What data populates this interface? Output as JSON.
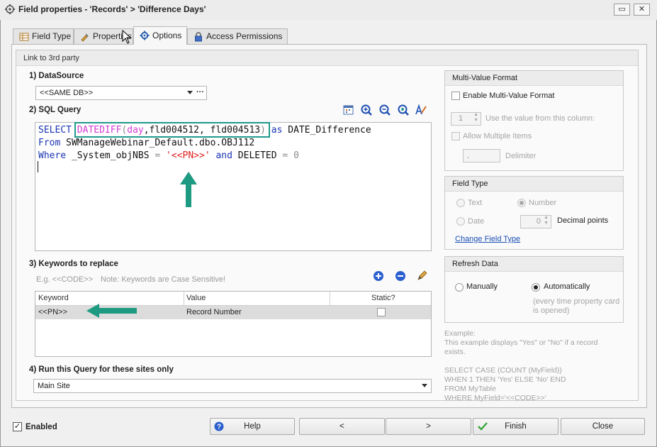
{
  "window": {
    "title": "Field properties - 'Records' > 'Difference Days'",
    "restore_glyph": "▭",
    "close_glyph": "✕"
  },
  "tabs": [
    {
      "label": "Field Type",
      "icon": "table-icon"
    },
    {
      "label": "Properties",
      "icon": "properties-icon"
    },
    {
      "label": "Options",
      "icon": "gear-icon"
    },
    {
      "label": "Access Permissions",
      "icon": "lock-icon"
    }
  ],
  "group": {
    "title": "Link to 3rd party"
  },
  "datasource": {
    "label": "1) DataSource",
    "value": "<<SAME DB>>",
    "more": "···"
  },
  "sql": {
    "label": "2) SQL Query",
    "line1": {
      "select": "SELECT",
      "fn": "DATEDIFF",
      "open": "(",
      "arg1": "day",
      "args_rest": ",fld004512, fld004513",
      "close": ")",
      "as": "as",
      "alias": "DATE_Difference"
    },
    "line2": {
      "from": "From",
      "table": "SWManageWebinar_Default.dbo.OBJ112"
    },
    "line3": {
      "where": "Where",
      "col": "_System_objNBS",
      "eq": "=",
      "str": "'<<PN>>'",
      "and": "and",
      "col2": "DELETED",
      "eq2": "=",
      "zero": "0"
    },
    "toolbar_icons": [
      "calendar-icon",
      "zoom-in-icon",
      "zoom-out-icon",
      "zoom-reset-icon",
      "format-icon"
    ]
  },
  "keywords": {
    "label": "3) Keywords to replace",
    "hint_example": "E.g. <<CODE>>",
    "hint_note": "Note: Keywords are Case Sensitive!",
    "columns": [
      "Keyword",
      "Value",
      "Static?"
    ],
    "rows": [
      {
        "keyword": "<<PN>>",
        "value": "Record Number",
        "static": false
      }
    ]
  },
  "sites": {
    "label": "4) Run this Query for these sites only",
    "value": "Main Site"
  },
  "multi_value": {
    "title": "Multi-Value Format",
    "enable_label": "Enable Multi-Value Format",
    "column_value": "1",
    "column_label": "Use the value from this column:",
    "allow_multiple_label": "Allow Multiple Items",
    "delimiter_value": ",",
    "delimiter_label": "Delimiter"
  },
  "field_type": {
    "title": "Field Type",
    "text_label": "Text",
    "number_label": "Number",
    "date_label": "Date",
    "decimal_value": "0",
    "decimal_label": "Decimal points",
    "change_link": "Change Field Type"
  },
  "refresh": {
    "title": "Refresh Data",
    "manually_label": "Manually",
    "auto_label": "Automatically",
    "auto_note_1": "(every time property card",
    "auto_note_2": "is opened)"
  },
  "example": {
    "lines": [
      "Example:",
      "This example displays \"Yes\" or \"No\" if a record",
      "exists.",
      "",
      "SELECT CASE (COUNT (MyField))",
      "WHEN 1 THEN 'Yes' ELSE 'No' END",
      "FROM MyTable",
      "WHERE MyField='<<CODE>>'"
    ]
  },
  "footer": {
    "enabled_label": "Enabled",
    "enabled_checked": true,
    "help": "Help",
    "prev": "<",
    "next": ">",
    "finish": "Finish",
    "close": "Close"
  },
  "colors": {
    "highlight_box": "#1f9a8c",
    "annotation_arrow": "#1f9a82",
    "sql_keyword": "#1a33b3",
    "sql_function": "#d23bd2",
    "sql_string": "#e02020"
  }
}
